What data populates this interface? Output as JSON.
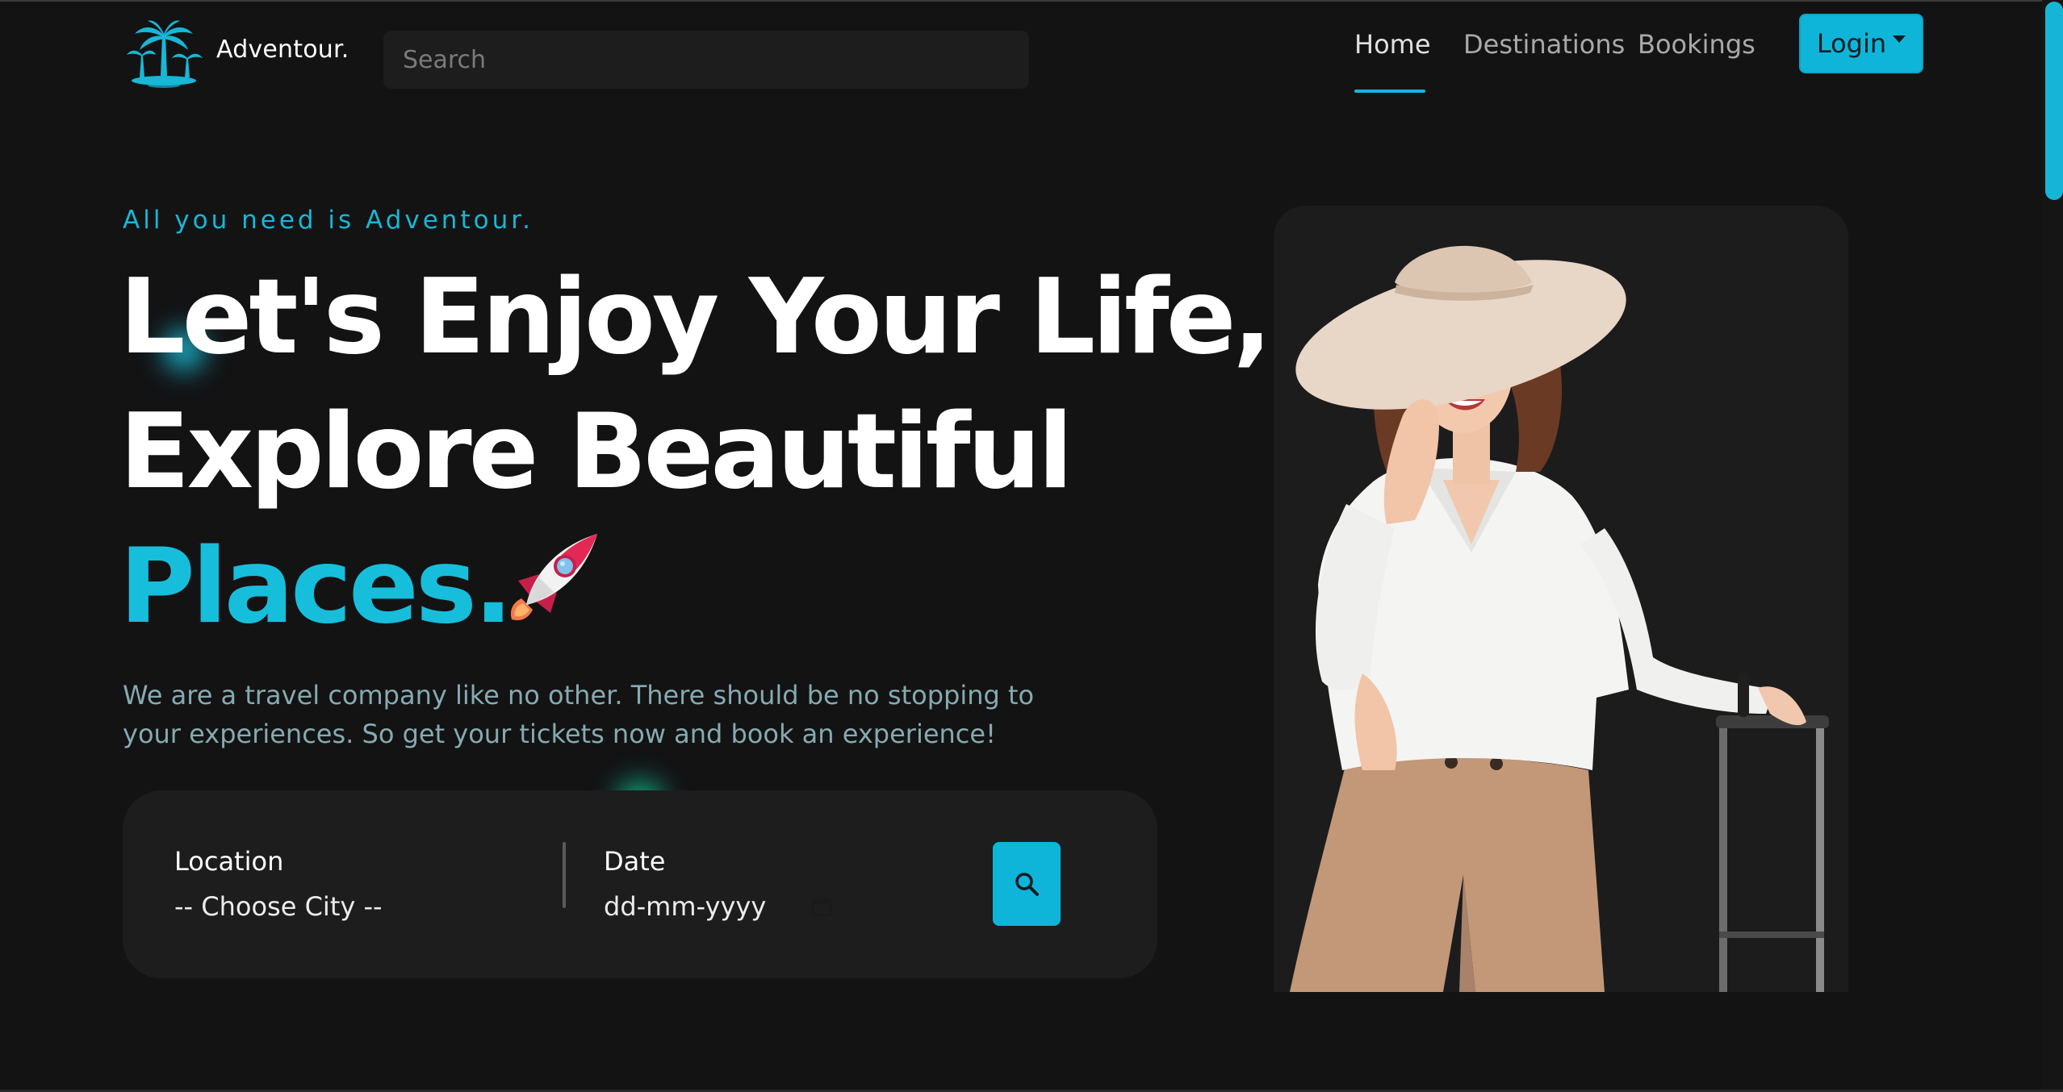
{
  "nav": {
    "brand": "Adventour.",
    "search_placeholder": "Search",
    "links": [
      {
        "label": "Home",
        "active": true
      },
      {
        "label": "Destinations",
        "active": false
      },
      {
        "label": "Bookings",
        "active": false
      }
    ],
    "login_label": "Login"
  },
  "hero": {
    "eyebrow": "All you need is Adventour.",
    "line1": "Let's Enjoy Your Life,",
    "line2": "Explore Beautiful",
    "line3": "Places.",
    "description": "We are a travel company like no other. There should be no stopping to your experiences. So get your tickets now and book an experience!"
  },
  "booking": {
    "location_label": "Location",
    "location_value": "-- Choose City --",
    "date_label": "Date",
    "date_placeholder": "dd-mm-yyyy"
  },
  "colors": {
    "accent": "#17b7d6",
    "background": "#131314",
    "surface": "#1d1d1e",
    "muted_text": "#86aab0"
  },
  "icons": {
    "logo": "palm-tree-icon",
    "rocket": "rocket-icon",
    "calendar": "calendar-icon",
    "search": "search-icon",
    "caret": "caret-down-icon"
  }
}
